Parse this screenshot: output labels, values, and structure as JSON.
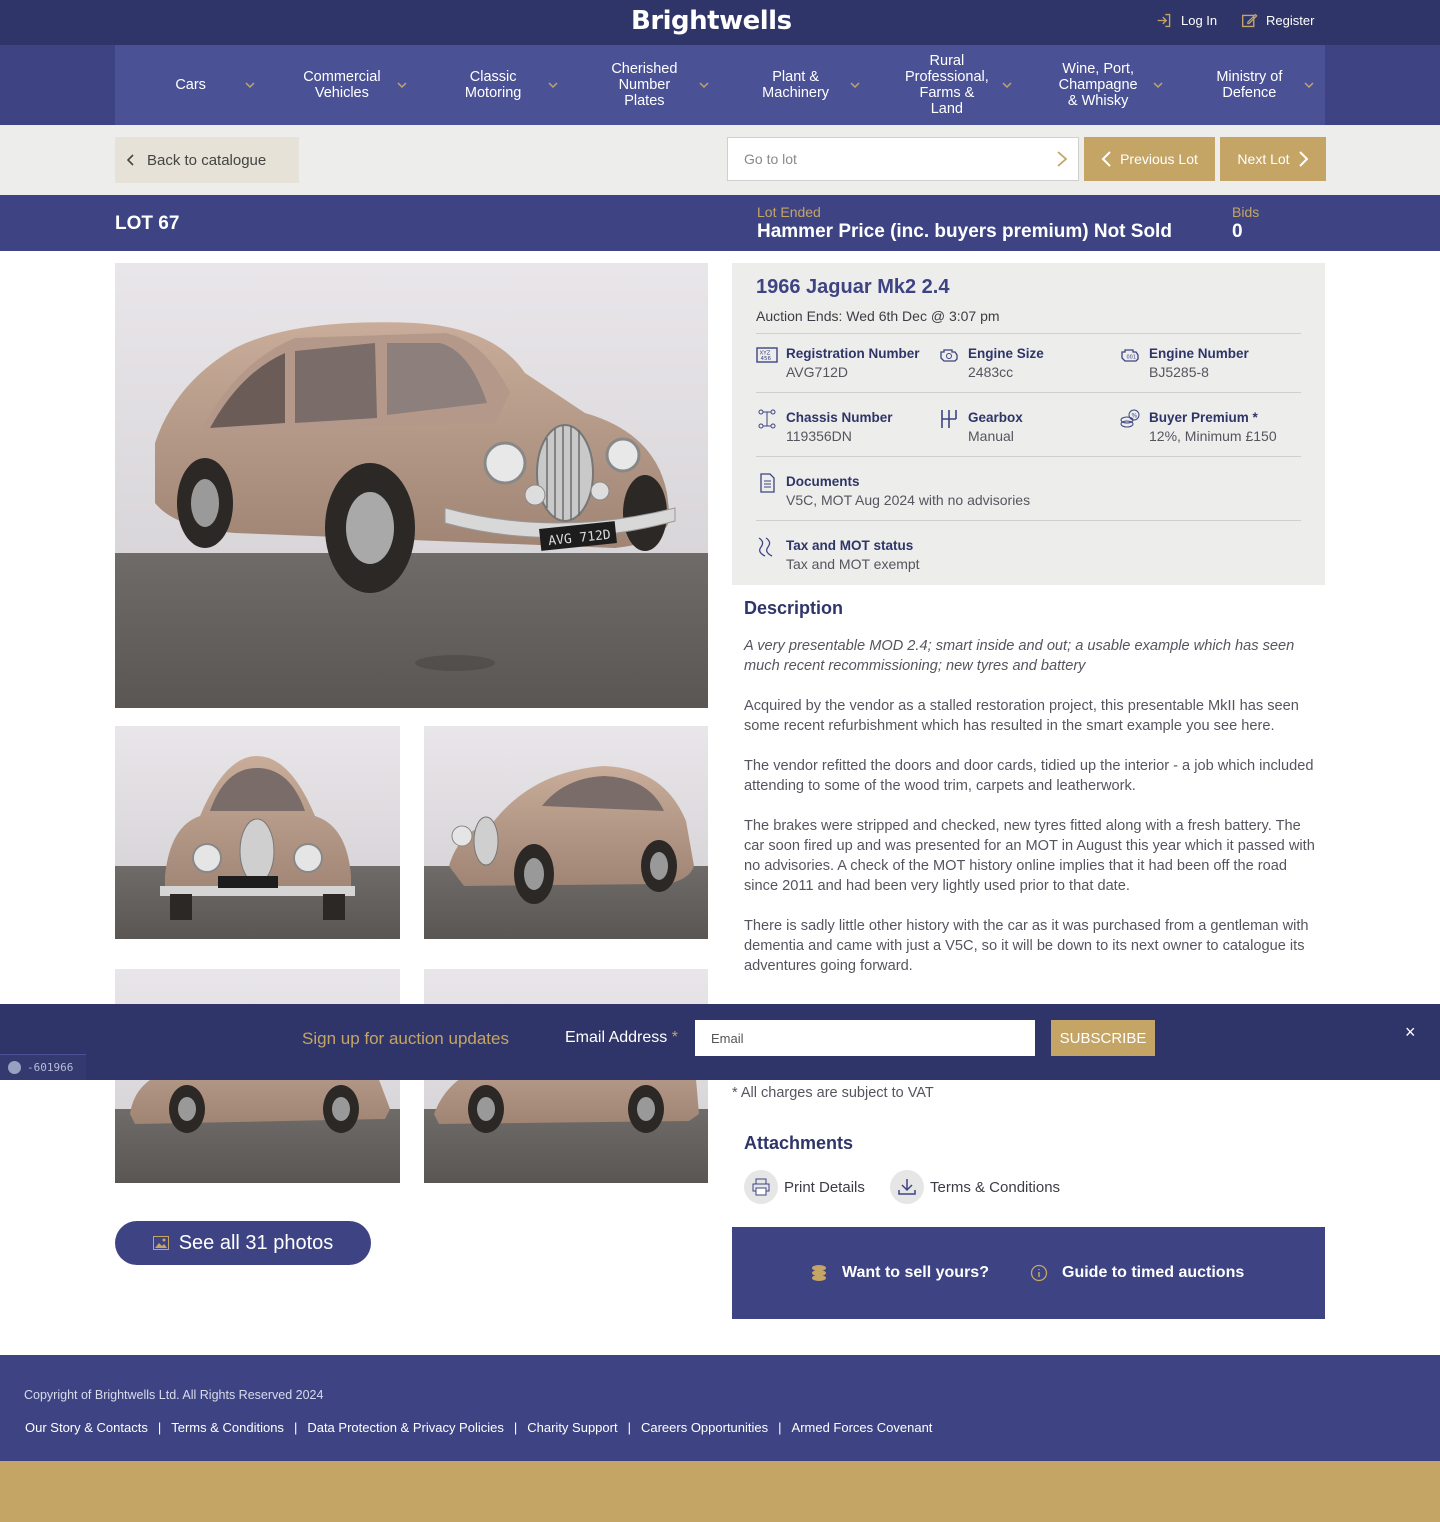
{
  "brand": {
    "logo": "Brightwells",
    "navy": "#2f3568",
    "nav_blue": "#3e4483",
    "gold": "#c4a566"
  },
  "header": {
    "login": "Log In",
    "register": "Register"
  },
  "nav": {
    "items": [
      {
        "label": "Cars"
      },
      {
        "label": "Commercial\nVehicles"
      },
      {
        "label": "Classic\nMotoring"
      },
      {
        "label": "Cherished\nNumber\nPlates"
      },
      {
        "label": "Plant &\nMachinery"
      },
      {
        "label": "Rural\nProfessional,\nFarms &\nLand"
      },
      {
        "label": "Wine, Port,\nChampagne\n& Whisky"
      },
      {
        "label": "Ministry of\nDefence"
      }
    ]
  },
  "toolbar": {
    "back": "Back to catalogue",
    "goto_placeholder": "Go to lot",
    "prev": "Previous Lot",
    "next": "Next Lot"
  },
  "lot": {
    "number": "LOT 67",
    "status_label": "Lot Ended",
    "price_text": "Hammer Price (inc. buyers premium) Not Sold",
    "bids_label": "Bids",
    "bids_value": "0"
  },
  "vehicle": {
    "title": "1966 Jaguar Mk2 2.4",
    "auction_ends": "Auction Ends: Wed 6th Dec @ 3:07 pm",
    "specs": {
      "registration": {
        "label": "Registration Number",
        "value": "AVG712D",
        "icon": "registration-plate-icon"
      },
      "engine_size": {
        "label": "Engine Size",
        "value": "2483cc",
        "icon": "engine-icon"
      },
      "engine_number": {
        "label": "Engine Number",
        "value": "BJ5285-8",
        "icon": "engine-number-icon"
      },
      "chassis": {
        "label": "Chassis Number",
        "value": "119356DN",
        "icon": "chassis-icon"
      },
      "gearbox": {
        "label": "Gearbox",
        "value": "Manual",
        "icon": "gearbox-icon"
      },
      "buyer_premium": {
        "label": "Buyer Premium *",
        "value": "12%, Minimum £150",
        "icon": "coins-icon"
      },
      "documents": {
        "label": "Documents",
        "value": "V5C, MOT Aug 2024 with no advisories",
        "icon": "document-icon"
      },
      "tax_mot": {
        "label": "Tax and MOT status",
        "value": "Tax and MOT exempt",
        "icon": "road-icon"
      }
    },
    "plate_text": "AVG 712D"
  },
  "description": {
    "heading": "Description",
    "paragraphs": [
      "A very presentable MOD 2.4; smart inside and out; a usable example which has seen much recent recommissioning; new tyres and battery",
      "Acquired by the vendor as a stalled restoration project, this presentable MkII has seen some recent refurbishment which has resulted in the smart example you see here.",
      "The vendor refitted the doors and door cards, tidied up the interior - a job which included attending to some of the wood trim, carpets and leatherwork.",
      "The brakes were stripped and checked, new tyres fitted along with a fresh battery. The car soon fired up and was presented for an MOT in August this year which it passed with no advisories. A check of the MOT history online implies that it had been off the road since 2011 and had been very lightly used prior to that date.",
      "There is sadly little other history with the car as it was purchased from a gentleman with dementia and came with just a V5C, so it will be down to its next owner to catalogue its adventures going forward."
    ],
    "vat_note": "* All charges are subject to VAT"
  },
  "attachments": {
    "heading": "Attachments",
    "print": "Print Details",
    "terms": "Terms & Conditions"
  },
  "gallery": {
    "see_all": "See all 31 photos"
  },
  "promo": {
    "sell": "Want to sell yours?",
    "guide": "Guide to timed auctions"
  },
  "signup": {
    "title": "Sign up for auction updates",
    "email_label": "Email Address",
    "required_mark": "*",
    "email_placeholder": "Email",
    "button": "SUBSCRIBE",
    "close": "×"
  },
  "debug_badge": "-601966",
  "footer": {
    "copyright": "Copyright of Brightwells Ltd. All Rights Reserved 2024",
    "links": [
      "Our Story & Contacts",
      "Terms & Conditions",
      "Data Protection & Privacy Policies",
      "Charity Support",
      "Careers Opportunities",
      "Armed Forces Covenant"
    ]
  }
}
